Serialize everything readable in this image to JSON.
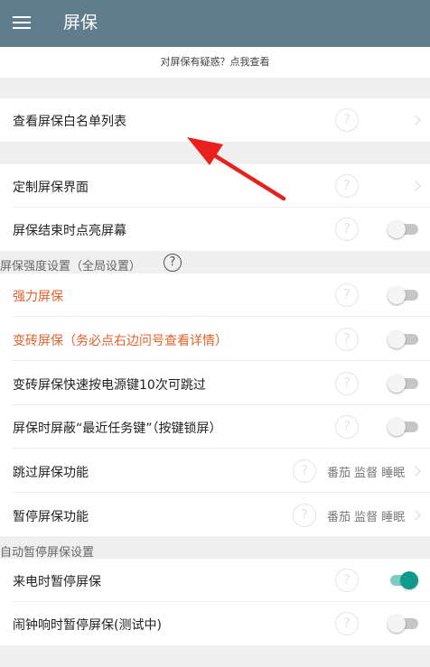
{
  "app": {
    "title": "屏保"
  },
  "faq": {
    "text": "对屏保有疑惑？点我查看"
  },
  "icons": {
    "help": "?",
    "section_help": "?"
  },
  "rows": {
    "whitelist": {
      "label": "查看屏保白名单列表"
    },
    "custom_ui": {
      "label": "定制屏保界面"
    },
    "screen_on_after": {
      "label": "屏保结束时点亮屏幕",
      "enabled": false
    }
  },
  "section_strength": {
    "header": "屏保强度设置（全局设置）",
    "strong": {
      "label": "强力屏保",
      "enabled": false
    },
    "brick": {
      "label": "变砖屏保（务必点右边问号查看详情）",
      "enabled": false
    },
    "brick_skip": {
      "label": "变砖屏保快速按电源键10次可跳过",
      "enabled": false
    },
    "block_recent": {
      "label": "屏保时屏蔽“最近任务键”（按键锁屏）",
      "enabled": false
    },
    "skip": {
      "label": "跳过屏保功能",
      "options": "番茄 监督 睡眠"
    },
    "pause": {
      "label": "暂停屏保功能",
      "options": "番茄 监督 睡眠"
    }
  },
  "section_auto_pause": {
    "header": "自动暂停屏保设置",
    "call": {
      "label": "来电时暂停屏保",
      "enabled": true
    },
    "alarm": {
      "label": "闹钟响时暂停屏保(测试中)",
      "enabled": false
    }
  },
  "colors": {
    "appbar": "#5f7d8c",
    "accent": "#0f9a8b",
    "warning_text": "#e0622a",
    "annotation_arrow": "#e8211f"
  }
}
